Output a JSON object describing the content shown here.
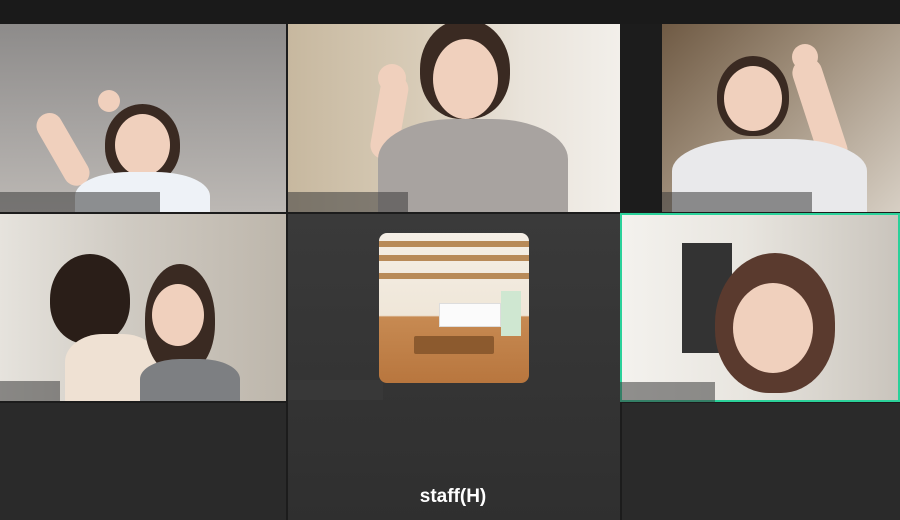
{
  "participants": [
    {
      "id": "p1",
      "active": false
    },
    {
      "id": "p2",
      "active": false
    },
    {
      "id": "p3",
      "active": false
    },
    {
      "id": "p4",
      "active": false
    },
    {
      "id": "p5",
      "active": false,
      "has_video": false
    },
    {
      "id": "p6",
      "active": true
    }
  ],
  "bottom_label": "staff(H)",
  "colors": {
    "active_border": "#2bd19a",
    "background": "#1c1c1c",
    "tile_dark": "#3a3a3a"
  }
}
